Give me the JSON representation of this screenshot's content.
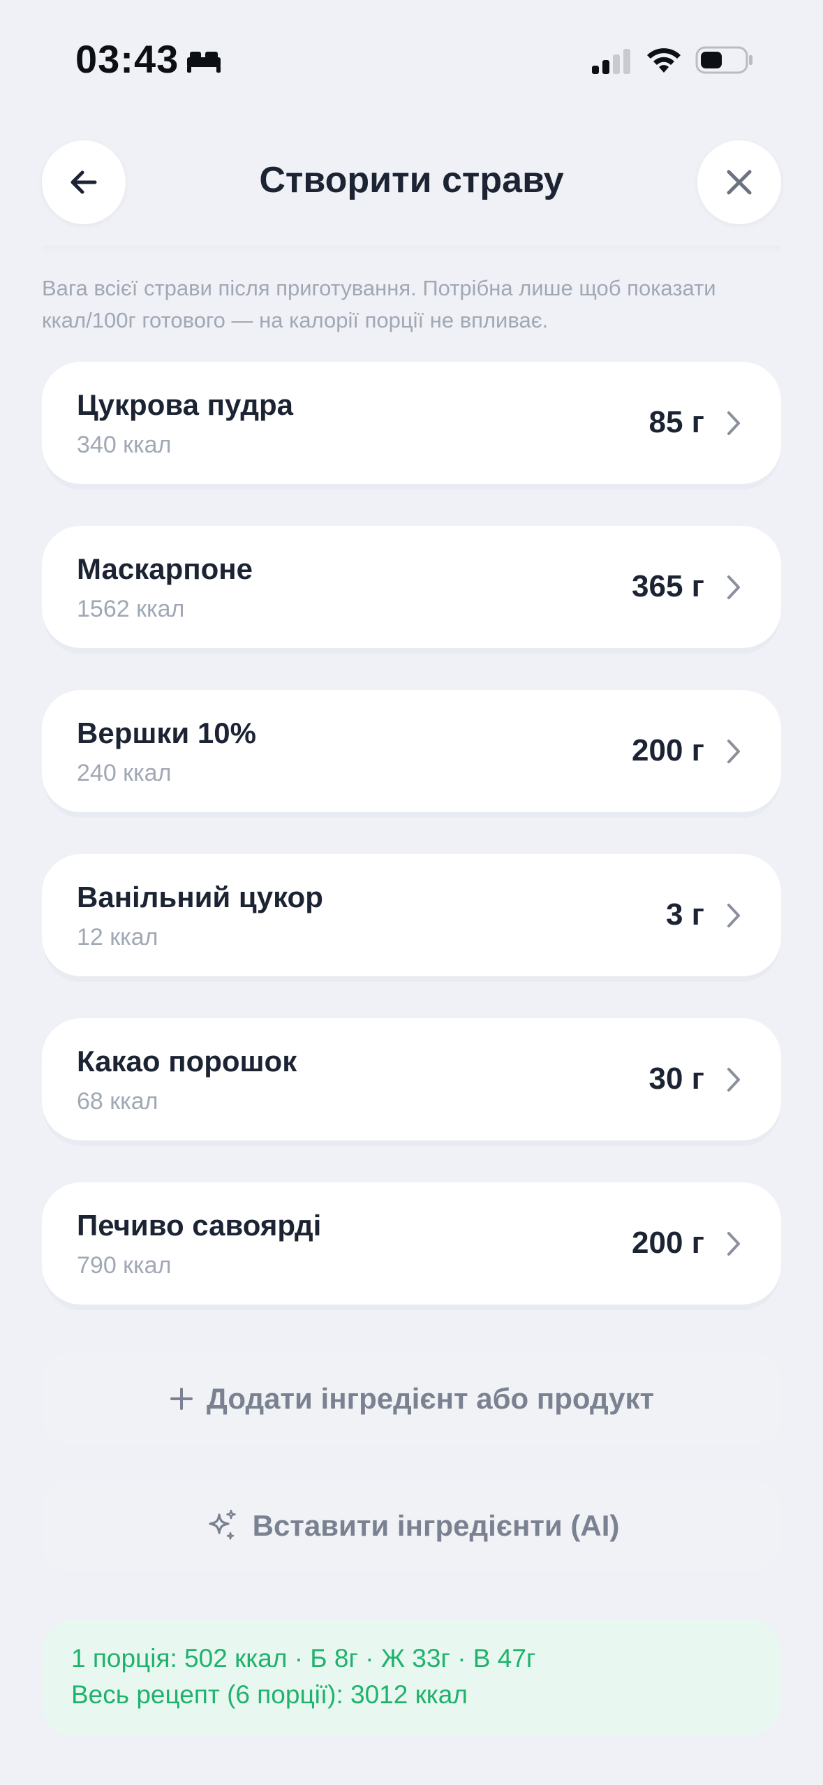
{
  "status_bar": {
    "time": "03:43"
  },
  "header": {
    "title": "Створити страву",
    "back_icon": "arrow-left-icon",
    "close_icon": "close-icon"
  },
  "hint": "Вага всієї страви після приготування. Потрібна лише щоб показати ккал/100г готового — на калорії порції не впливає.",
  "ingredients": [
    {
      "name": "Цукрова пудра",
      "kcal": "340 ккал",
      "amount": "85 г"
    },
    {
      "name": "Маскарпоне",
      "kcal": "1562 ккал",
      "amount": "365 г"
    },
    {
      "name": "Вершки 10%",
      "kcal": "240 ккал",
      "amount": "200 г"
    },
    {
      "name": "Ванільний цукор",
      "kcal": "12 ккал",
      "amount": "3 г"
    },
    {
      "name": "Какао порошок",
      "kcal": "68 ккал",
      "amount": "30 г"
    },
    {
      "name": "Печиво савоярді",
      "kcal": "790 ккал",
      "amount": "200 г"
    }
  ],
  "actions": {
    "add_label": "Додати інгредієнт або продукт",
    "ai_label": "Вставити інгредієнти (AI)"
  },
  "summary": {
    "line1": "1 порція: 502 ккал · Б 8г · Ж 33г · В 47г",
    "line2": "Весь рецепт (6 порції): 3012 ккал"
  },
  "colors": {
    "background": "#eff1f6",
    "card": "#ffffff",
    "text": "#1c2433",
    "muted": "#a1a8b5",
    "accent_green": "#20b26d",
    "summary_bg": "#e8f8f0"
  }
}
